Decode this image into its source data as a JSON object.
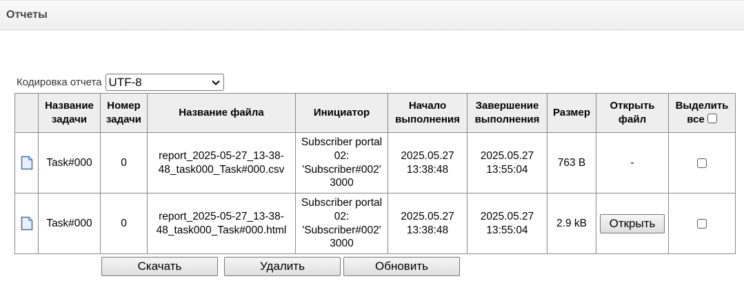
{
  "panel": {
    "title": "Отчеты"
  },
  "encoding": {
    "label": "Кодировка отчета",
    "selected": "UTF-8"
  },
  "table": {
    "headers": {
      "task_name": "Название задачи",
      "task_number": "Номер задачи",
      "file_name": "Название файла",
      "initiator": "Инициатор",
      "start": "Начало выполнения",
      "end": "Завершение выполнения",
      "size": "Размер",
      "open_file": "Открыть файл",
      "select_all": "Выделить все"
    },
    "rows": [
      {
        "icon": "document-icon",
        "task_name": "Task#000",
        "task_number": "0",
        "file_name": "report_2025-05-27_13-38-48_task000_Task#000.csv",
        "initiator": "Subscriber portal 02: 'Subscriber#002' 3000",
        "start": "2025.05.27 13:38:48",
        "end": "2025.05.27 13:55:04",
        "size": "763 B",
        "open": "-",
        "checked": false
      },
      {
        "icon": "document-icon",
        "task_name": "Task#000",
        "task_number": "0",
        "file_name": "report_2025-05-27_13-38-48_task000_Task#000.html",
        "initiator": "Subscriber portal 02: 'Subscriber#002' 3000",
        "start": "2025.05.27 13:38:48",
        "end": "2025.05.27 13:55:04",
        "size": "2.9 kB",
        "open": "Открыть",
        "checked": false
      }
    ]
  },
  "actions": {
    "download": "Скачать",
    "delete": "Удалить",
    "refresh": "Обновить"
  },
  "colors": {
    "header_bg": "#eeeeee",
    "border": "#888888",
    "icon_blue": "#3a6fb8"
  }
}
